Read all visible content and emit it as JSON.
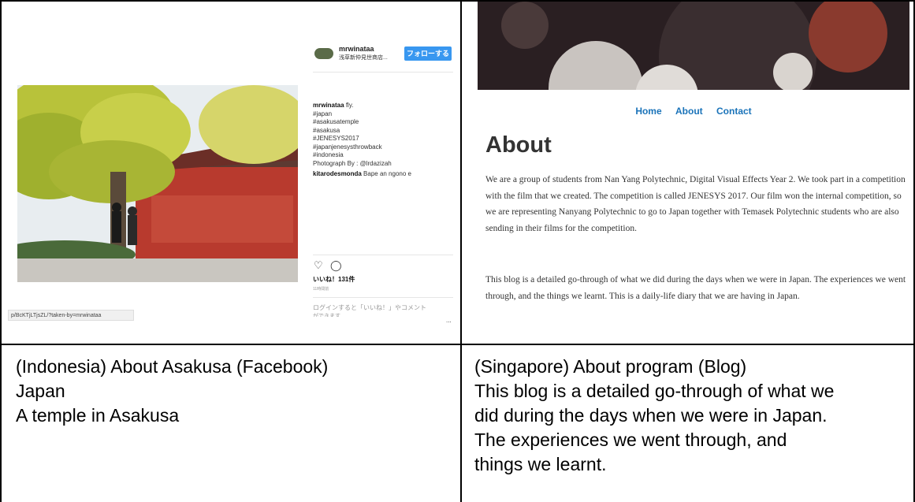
{
  "left_cell": {
    "instagram": {
      "username": "mrwinataa",
      "location": "浅草新仲見世商店...",
      "follow_label": "フォローする",
      "caption_user": "mrwinataa",
      "caption_first": "fly.",
      "hashtags": [
        "#japan",
        "#asakusatemple",
        "#asakusa",
        "#JENESYS2017",
        "#japanjenesysthrowback",
        "#indonesia"
      ],
      "photo_credit": "Photograph By : @lrdazizah",
      "comment_user": "kitarodesmonda",
      "comment_text": "Bape an ngono e",
      "likes": "いいね！131件",
      "time": "11時間前",
      "login_prompt": "ログインすると「いいね！」やコメント",
      "login_prompt_tail": "ができます",
      "url": "p/BcKTjLTjsZL/?taken-by=mrwinataa",
      "dots": "..."
    },
    "caption_lines": [
      "(Indonesia) About Asakusa (Facebook)",
      "Japan",
      "A temple in Asakusa"
    ]
  },
  "right_cell": {
    "blog": {
      "nav": [
        "Home",
        "About",
        "Contact"
      ],
      "title": "About",
      "paragraph_1": "We are a group of students from Nan Yang Polytechnic, Digital Visual Effects Year 2. We took part in a competition with the film that we created. The competition is called JENESYS 2017. Our film won the internal competition, so we are representing Nanyang Polytechnic to go to Japan together with Temasek Polytechnic students who are also sending in their films for the competition.",
      "paragraph_2": "This blog is a detailed go-through of what we did during the days when we were in Japan. The experiences we went through, and the things we learnt. This is a daily-life diary that we are having in Japan."
    },
    "caption_lines": [
      "(Singapore) About program (Blog)",
      "This blog is a detailed go-through of what we",
      "did during the days when we were in Japan.",
      "The experiences we went through, and",
      "things we learnt."
    ]
  },
  "colors": {
    "instagram_blue": "#3897f0",
    "blog_link": "#1a73b9",
    "border": "#000000"
  }
}
